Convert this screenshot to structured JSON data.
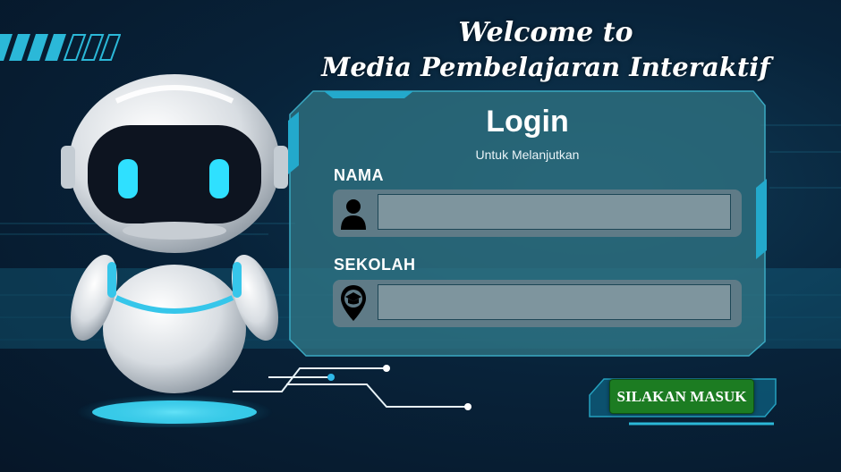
{
  "header": {
    "welcome_line1": "Welcome to",
    "welcome_line2": "Media Pembelajaran Interaktif"
  },
  "login": {
    "title": "Login",
    "subtitle": "Untuk Melanjutkan"
  },
  "form": {
    "nama_label": "NAMA",
    "nama_value": "",
    "sekolah_label": "SEKOLAH",
    "sekolah_value": ""
  },
  "actions": {
    "submit_label": "SILAKAN MASUK"
  },
  "icons": {
    "nama_icon": "person-icon",
    "sekolah_icon": "school-location-pin-icon"
  },
  "colors": {
    "accent": "#22c8e8",
    "button": "#1c7c22",
    "panel": "#2a6f80"
  }
}
